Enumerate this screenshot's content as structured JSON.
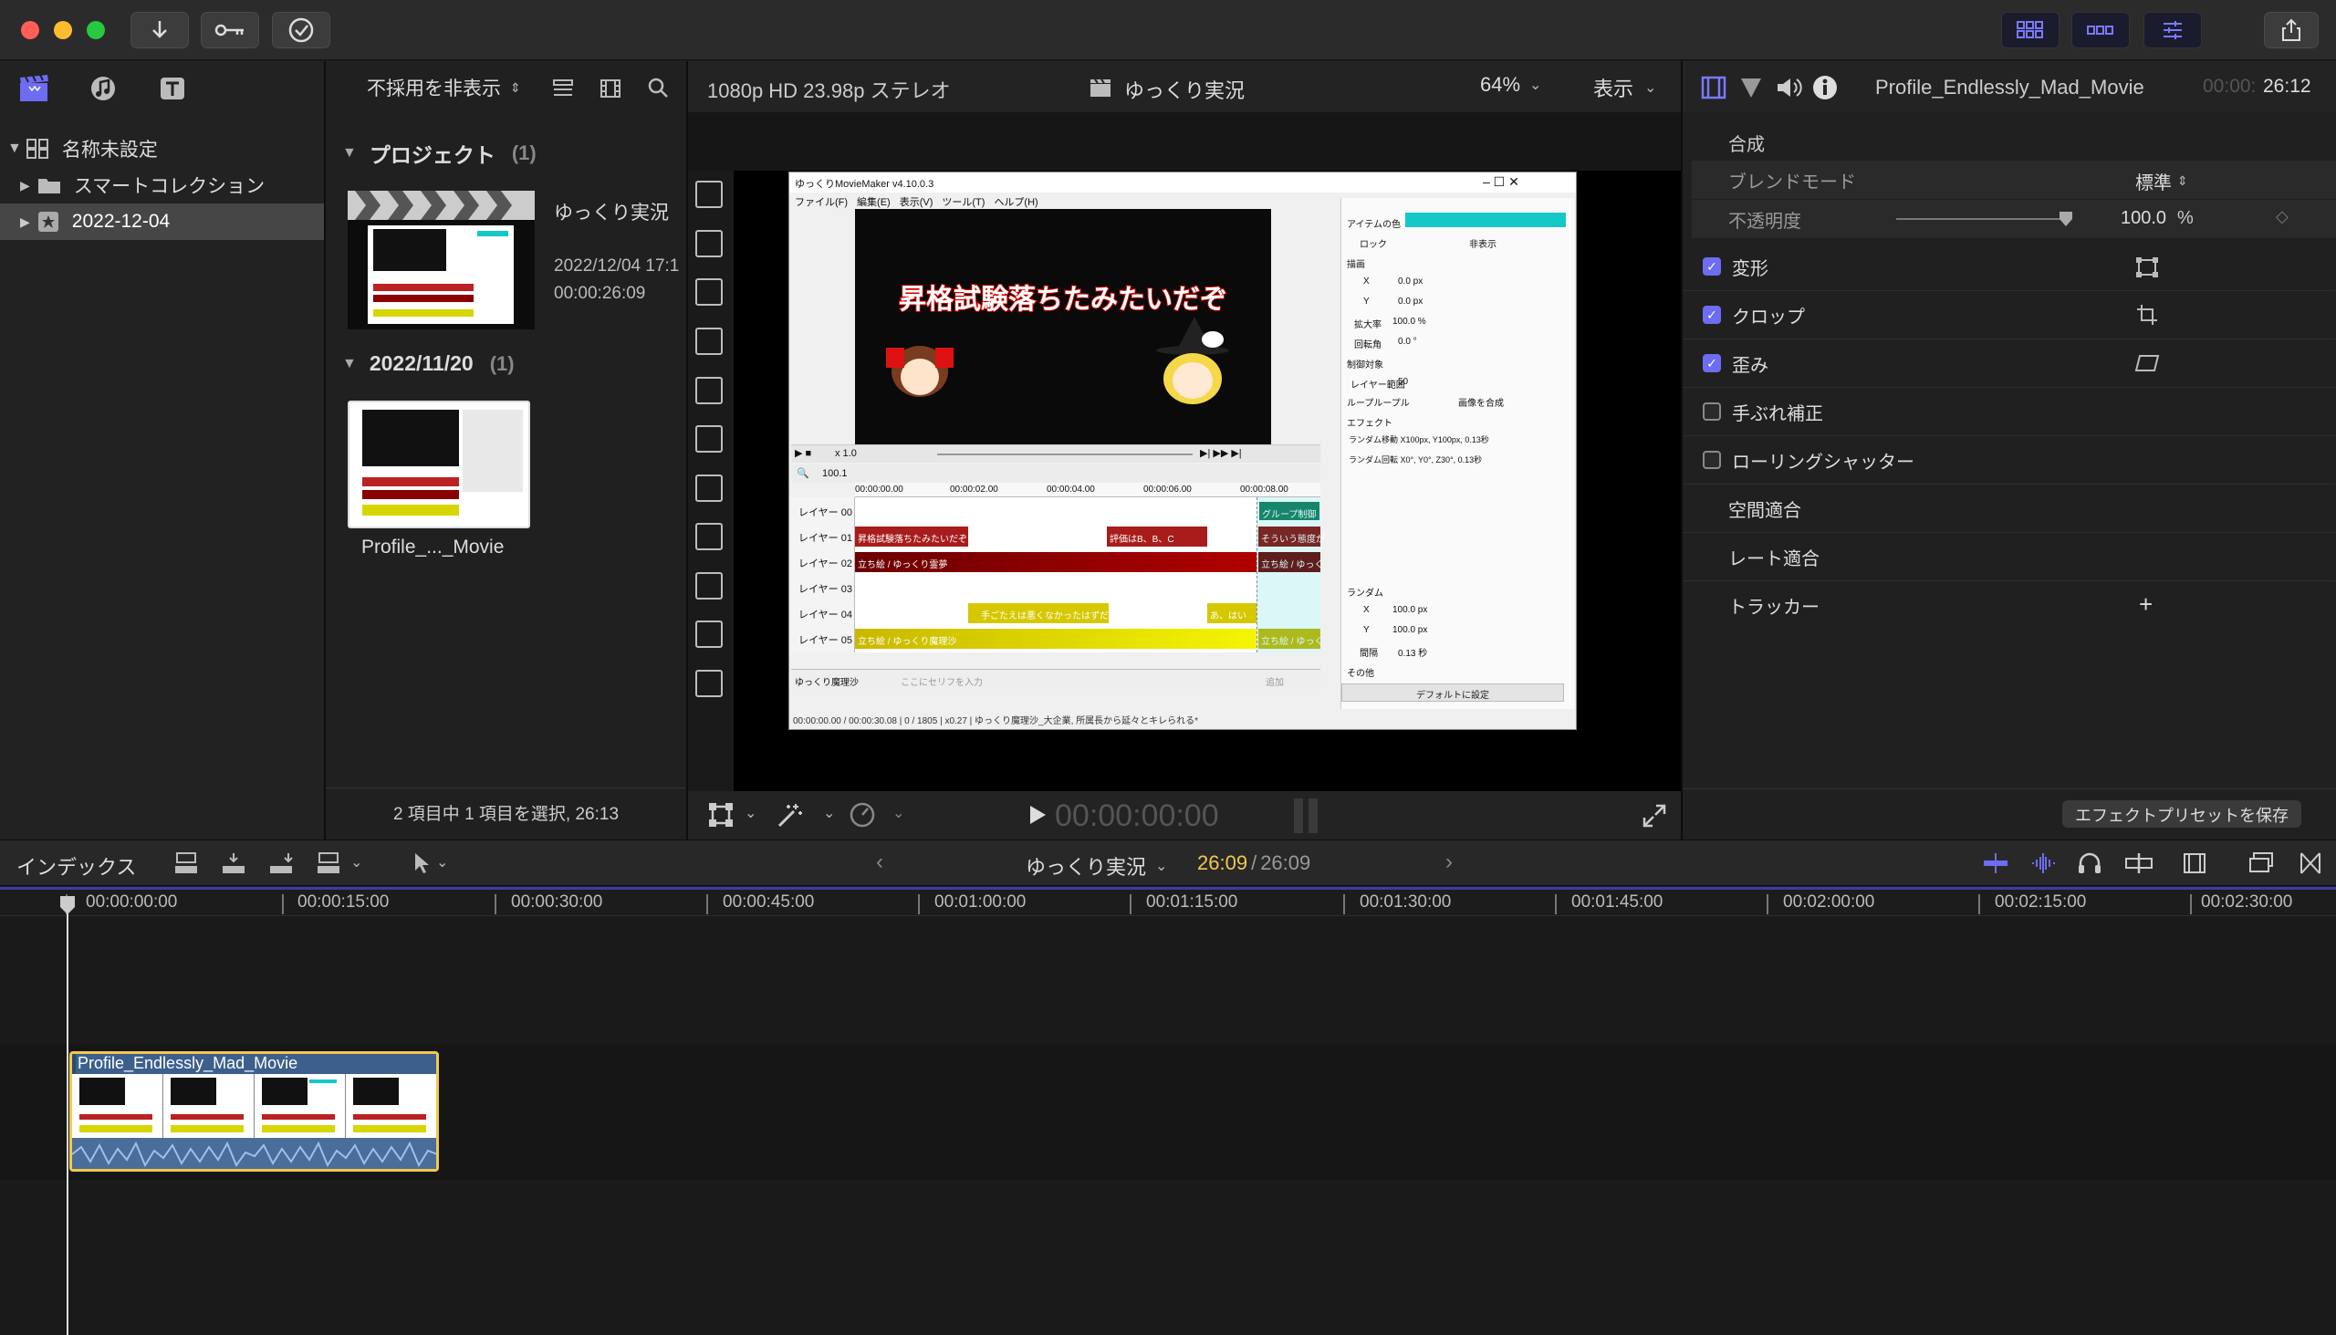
{
  "toolbar": {
    "window_controls": [
      "close",
      "minimize",
      "zoom"
    ],
    "import_icon": "download-arrow-icon",
    "keyword_icon": "key-icon",
    "background_tasks_icon": "checkmark-circle-icon",
    "share_icon": "share-icon"
  },
  "browser": {
    "filter_label": "不採用を非表示",
    "library": [
      {
        "label": "名称未設定",
        "icon": "library-icon"
      },
      {
        "label": "スマートコレクション",
        "icon": "folder-icon"
      },
      {
        "label": "2022-12-04",
        "icon": "event-star-icon"
      }
    ],
    "sections": [
      {
        "title": "プロジェクト",
        "count": "(1)"
      },
      {
        "title": "2022/11/20",
        "count": "(1)"
      }
    ],
    "project": {
      "name": "ゆっくり実況",
      "date": "2022/12/04 17:1",
      "duration": "00:00:26:09"
    },
    "clip_name": "Profile_..._Movie",
    "status": "2 項目中 1 項目を選択, 26:13"
  },
  "viewer": {
    "format": "1080p HD 23.98p ステレオ",
    "project": "ゆっくり実況",
    "zoom": "64%",
    "view_label": "表示",
    "timecode": "00:00:00:00"
  },
  "ymm": {
    "title": "ゆっくりMovieMaker v4.10.0.3",
    "menu": [
      "ファイル(F)",
      "編集(E)",
      "表示(V)",
      "ツール(T)",
      "ヘルプ(H)"
    ],
    "caption": "昇格試験落ちたみたいだぞ",
    "speed": "x 1.0",
    "zoom": "100.1",
    "times": [
      "00:00:00.00",
      "00:00:02.00",
      "00:00:04.00",
      "00:00:06.00",
      "00:00:08.00"
    ],
    "layers": [
      "レイヤー 00",
      "レイヤー 01",
      "レイヤー 02",
      "レイヤー 03",
      "レイヤー 04",
      "レイヤー 05"
    ],
    "clips": {
      "group": "グループ制御",
      "l1a": "昇格試験落ちたみたいだぞ",
      "l1b": "評価はB、B、C",
      "l1c": "そういう態度が",
      "l2a": "立ち絵 / ゆっくり霊夢",
      "l2b": "立ち絵 / ゆっく",
      "l4a": "手ごたえは悪くなかったはずだ",
      "l4b": "あ、はい",
      "l5a": "立ち絵 / ゆっくり魔理沙",
      "l5b": "立ち絵 / ゆっく"
    },
    "speaker": "ゆっくり魔理沙",
    "input_placeholder": "ここにセリフを入力",
    "add": "追加",
    "status": "00:00:00.00 / 00:00:30.08 | 0 / 1805 | x0.27 | ゆっくり魔理沙_大企業, 所属長から延々とキレられる*",
    "props": {
      "item_color": "アイテムの色",
      "lock": "ロック",
      "hide": "非表示",
      "section_pos": "描画",
      "x": "X",
      "y": "Y",
      "zoom": "拡大率",
      "rotate": "回転角",
      "pxv": "0.0 px",
      "zoomv": "100.0 %",
      "rotv": "0.0 °",
      "control": "制御対象",
      "layer_range": "レイヤー範囲",
      "layer_range_v": "50",
      "group_loop": "ループループル",
      "composite": "画像を合成",
      "effects": "エフェクト",
      "eff1": "ランダム移動 X100px, Y100px, 0.13秒",
      "eff2": "ランダム回転 X0°, Y0°, Z30°, 0.13秒",
      "random": "ランダム",
      "rx": "100.0 px",
      "ry": "100.0 px",
      "interval": "間隔",
      "intervalv": "0.13 秒",
      "other": "その他",
      "default": "デフォルトに設定"
    }
  },
  "inspector": {
    "clip_name": "Profile_Endlessly_Mad_Movie",
    "tc_dim": "00:00:",
    "tc": "26:12",
    "composite": "合成",
    "blend_label": "ブレンドモード",
    "blend_value": "標準",
    "opacity_label": "不透明度",
    "opacity_value": "100.0",
    "opacity_unit": "%",
    "opacity_fraction": 1.0,
    "rows": [
      {
        "label": "変形",
        "checked": true,
        "icon": "transform-icon"
      },
      {
        "label": "クロップ",
        "checked": true,
        "icon": "crop-icon"
      },
      {
        "label": "歪み",
        "checked": true,
        "icon": "distort-icon"
      },
      {
        "label": "手ぶれ補正",
        "checked": false
      },
      {
        "label": "ローリングシャッター",
        "checked": false
      }
    ],
    "plain_rows": [
      "空間適合",
      "レート適合"
    ],
    "tracker": "トラッカー",
    "save_preset": "エフェクトプリセットを保存"
  },
  "timeline": {
    "index": "インデックス",
    "project": "ゆっくり実況",
    "tc_current": "26:09",
    "tc_sep": "/",
    "tc_total": "26:09",
    "ruler": [
      "00:00:00:00",
      "00:00:15:00",
      "00:00:30:00",
      "00:00:45:00",
      "00:01:00:00",
      "00:01:15:00",
      "00:01:30:00",
      "00:01:45:00",
      "00:02:00:00",
      "00:02:15:00",
      "00:02:30:00"
    ],
    "clip": "Profile_Endlessly_Mad_Movie"
  },
  "colors": {
    "accent": "#6e6cf0",
    "yellow": "#f2c94c",
    "teal": "#16c7c7"
  }
}
